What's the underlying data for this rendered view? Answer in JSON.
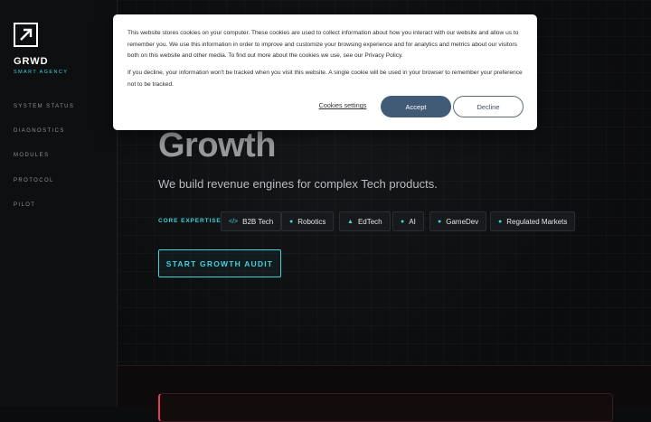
{
  "sidebar": {
    "brand": "GRWD",
    "tagline": "SMART AGENCY",
    "logo_icon": "arrow-up-right-icon",
    "nav": [
      {
        "label": "SYSTEM STATUS"
      },
      {
        "label": "DIAGNOSTICS"
      },
      {
        "label": "MODULES"
      },
      {
        "label": "PROTOCOL"
      },
      {
        "label": "PILOT"
      }
    ]
  },
  "hero": {
    "title": "Growth",
    "subtitle": "We build revenue engines for complex Tech products.",
    "expertise_label": "CORE EXPERTISE:",
    "chips": [
      {
        "label": "B2B Tech",
        "icon": "code-icon",
        "glyph": "</>"
      },
      {
        "label": "Robotics",
        "icon": "robot-icon",
        "glyph": "●"
      },
      {
        "label": "EdTech",
        "icon": "graduation-cap-icon",
        "glyph": "▲"
      },
      {
        "label": "AI",
        "icon": "ai-dot-icon",
        "glyph": "●"
      },
      {
        "label": "GameDev",
        "icon": "gamepad-icon",
        "glyph": "●"
      },
      {
        "label": "Regulated Markets",
        "icon": "shield-icon",
        "glyph": "●"
      }
    ],
    "cta_label": "START GROWTH AUDIT"
  },
  "cookie": {
    "paragraph1": "This website stores cookies on your computer. These cookies are used to collect information about how you interact with our website and allow us to remember you. We use this information in order to improve and customize your browsing experience and for analytics and metrics about our visitors both on this website and other media. To find out more about the cookies we use, see our Privacy Policy.",
    "paragraph2": "If you decline, your information won't be tracked when you visit this website. A single cookie will be used in your browser to remember your preference not to be tracked.",
    "settings_label": "Cookies settings",
    "accept_label": "Accept",
    "decline_label": "Decline"
  },
  "colors": {
    "accent": "#3fd3dc",
    "accept_button": "#415a75",
    "alert_red": "#e83a4c"
  }
}
